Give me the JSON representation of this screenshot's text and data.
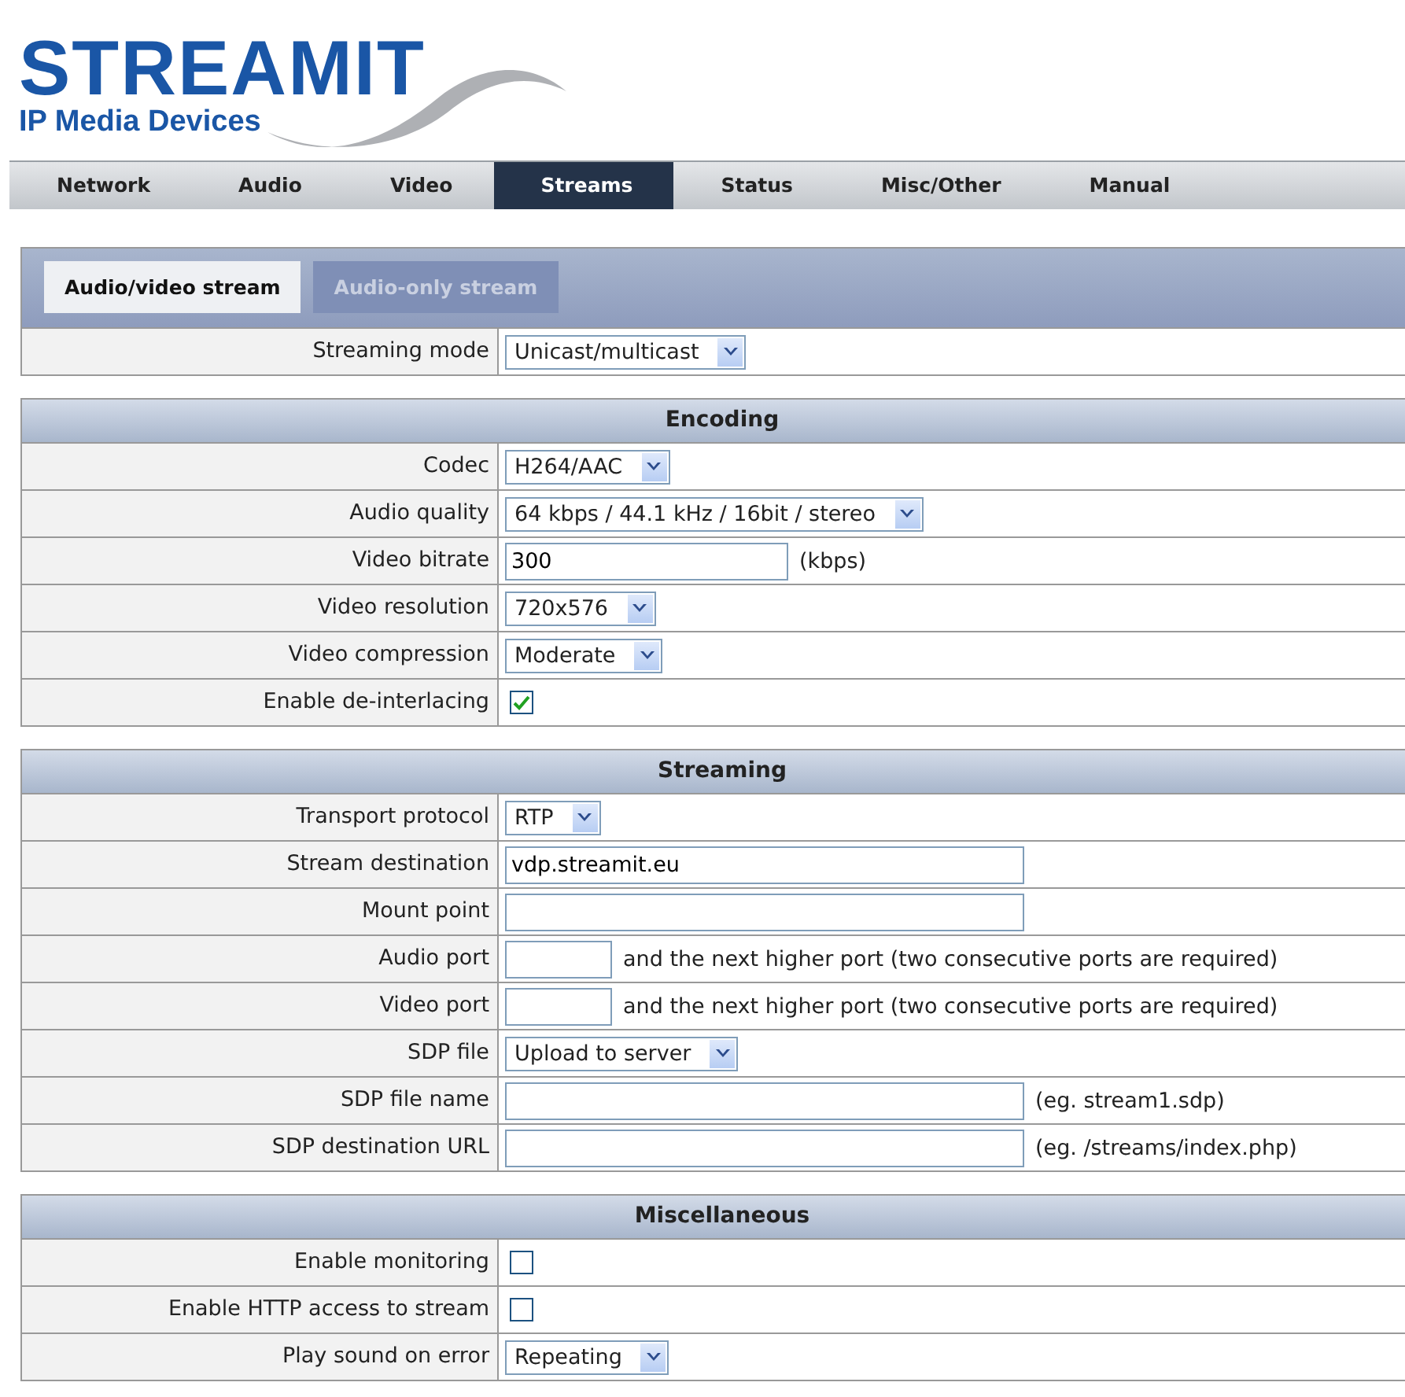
{
  "logo": {
    "name": "STREAMIT",
    "tagline": "IP Media Devices"
  },
  "nav": [
    {
      "label": "Network",
      "selected": false
    },
    {
      "label": "Audio",
      "selected": false
    },
    {
      "label": "Video",
      "selected": false
    },
    {
      "label": "Streams",
      "selected": true
    },
    {
      "label": "Status",
      "selected": false
    },
    {
      "label": "Misc/Other",
      "selected": false
    },
    {
      "label": "Manual",
      "selected": false
    }
  ],
  "stream_tabs": [
    {
      "label": "Audio/video stream",
      "selected": true
    },
    {
      "label": "Audio-only stream",
      "selected": false
    }
  ],
  "top_rows": [
    {
      "label": "Streaming mode",
      "kind": "select",
      "value": "Unicast/multicast"
    }
  ],
  "sections": [
    {
      "title": "Encoding",
      "rows": [
        {
          "label": "Codec",
          "kind": "select",
          "value": "H264/AAC"
        },
        {
          "label": "Audio quality",
          "kind": "select",
          "value": "64 kbps / 44.1 kHz / 16bit / stereo"
        },
        {
          "label": "Video bitrate",
          "kind": "medium",
          "value": "300",
          "note": "(kbps)"
        },
        {
          "label": "Video resolution",
          "kind": "select",
          "value": "720x576"
        },
        {
          "label": "Video compression",
          "kind": "select",
          "value": "Moderate"
        },
        {
          "label": "Enable de-interlacing",
          "kind": "checkbox",
          "checked": true
        }
      ]
    },
    {
      "title": "Streaming",
      "rows": [
        {
          "label": "Transport protocol",
          "kind": "select",
          "value": "RTP"
        },
        {
          "label": "Stream destination",
          "kind": "wide",
          "value": "vdp.streamit.eu"
        },
        {
          "label": "Mount point",
          "kind": "wide"
        },
        {
          "label": "Audio port",
          "kind": "short",
          "note": "and the next higher port (two consecutive ports are required)"
        },
        {
          "label": "Video port",
          "kind": "short",
          "note": "and the next higher port (two consecutive ports are required)"
        },
        {
          "label": "SDP file",
          "kind": "select",
          "value": "Upload to server"
        },
        {
          "label": "SDP file name",
          "kind": "wide",
          "note": "(eg. stream1.sdp)"
        },
        {
          "label": "SDP destination URL",
          "kind": "wide",
          "note": "(eg. /streams/index.php)"
        }
      ]
    },
    {
      "title": "Miscellaneous",
      "rows": [
        {
          "label": "Enable monitoring",
          "kind": "checkbox",
          "checked": false
        },
        {
          "label": "Enable HTTP access to stream",
          "kind": "checkbox",
          "checked": false
        },
        {
          "label": "Play sound on error",
          "kind": "select",
          "value": "Repeating"
        }
      ]
    }
  ]
}
